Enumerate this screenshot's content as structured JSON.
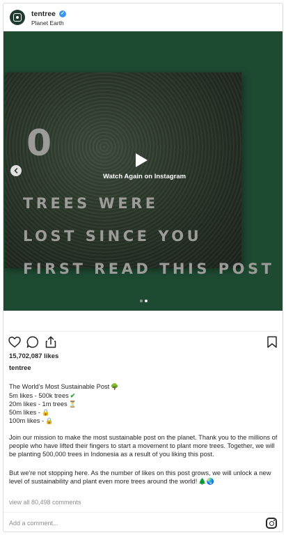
{
  "post": {
    "username": "tentree",
    "location": "Planet Earth",
    "verified_glyph": "✓"
  },
  "media": {
    "counter": "0",
    "line1": "TREES WERE",
    "line2": "LOST SINCE  YOU",
    "line3": "FIRST READ THIS POST",
    "watch_again": "Watch Again on Instagram",
    "slides": 2,
    "active_slide": 2
  },
  "engagement": {
    "likes": "15,702,087 likes",
    "owner": "tentree"
  },
  "caption": {
    "title": "The World's Most Sustainable Post",
    "title_emoji": "🌳",
    "tiers": [
      {
        "text": "5m likes - 500k trees",
        "emoji": "✔"
      },
      {
        "text": "20m likes - 1m trees",
        "emoji": "⏳"
      },
      {
        "text": "50m likes -",
        "emoji": "🔒"
      },
      {
        "text": "100m likes -",
        "emoji": "🔒"
      }
    ],
    "paragraph1": "Join our mission to make the most sustainable post on the planet. Thank you to the millions of people who have lifted their fingers to start a movement to plant more trees. Together, we will be planting 500,000 trees in Indonesia as a result of you liking this post.",
    "paragraph2": "But we're not stopping here. As the number of likes on this post grows, we will unlock a new level of sustainability and plant even more trees around the world!",
    "paragraph2_emoji": "🌲🌏"
  },
  "comments": {
    "view_all": "view all 80,498 comments",
    "placeholder": "Add a comment..."
  },
  "icons": {
    "avatar": "tentree-logo-icon",
    "verified": "verified-badge-icon",
    "play": "play-icon",
    "prev": "chevron-left-icon",
    "like": "heart-icon",
    "comment": "comment-bubble-icon",
    "share": "share-icon",
    "save": "bookmark-icon",
    "brand": "instagram-icon"
  },
  "colors": {
    "media_background": "#1e4a32",
    "verified_blue": "#3897f0",
    "text_primary": "#262626",
    "text_secondary": "#8e8e8e"
  }
}
